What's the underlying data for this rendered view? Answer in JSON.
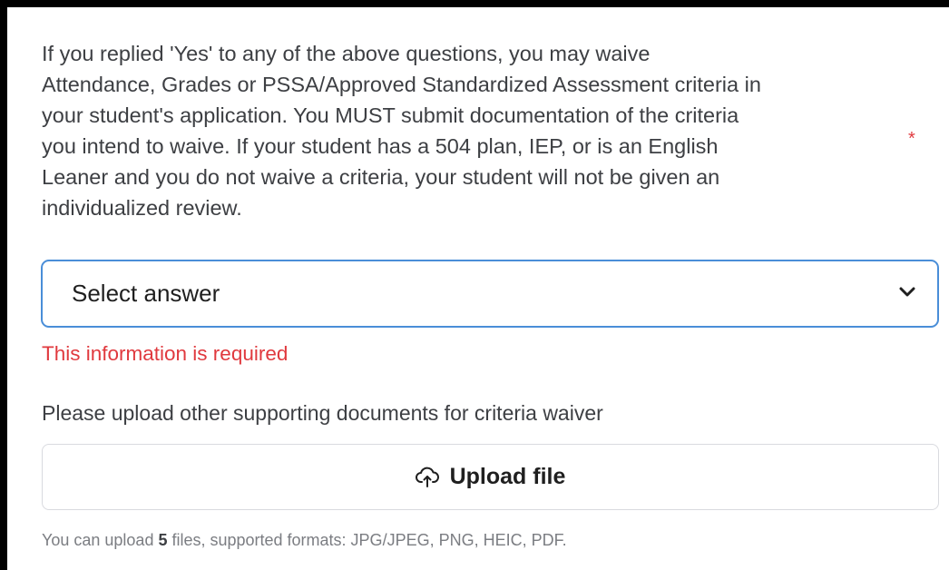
{
  "question": {
    "text": "If you replied 'Yes' to any of the above questions, you may waive\nAttendance, Grades or PSSA/Approved Standardized Assessment criteria in\nyour student's application. You MUST submit documentation of the criteria\nyou intend to waive.  If your student has a 504 plan, IEP, or is an English\nLeaner and you do not waive a criteria, your student will not be given an\nindividualized review.",
    "required_marker": "*"
  },
  "select": {
    "value": "Select answer",
    "icon": "chevron-down-icon"
  },
  "validation": {
    "error": "This information is required"
  },
  "upload": {
    "label": "Please upload other supporting documents for criteria waiver",
    "button_label": "Upload file",
    "icon": "cloud-upload-icon",
    "hint_prefix": "You can upload ",
    "hint_count": "5",
    "hint_suffix": " files, supported formats: JPG/JPEG, PNG, HEIC, PDF."
  },
  "colors": {
    "error": "#e0393e",
    "focus_border": "#4a8ed8",
    "text": "#3d3f43",
    "muted": "#7b7d82"
  }
}
